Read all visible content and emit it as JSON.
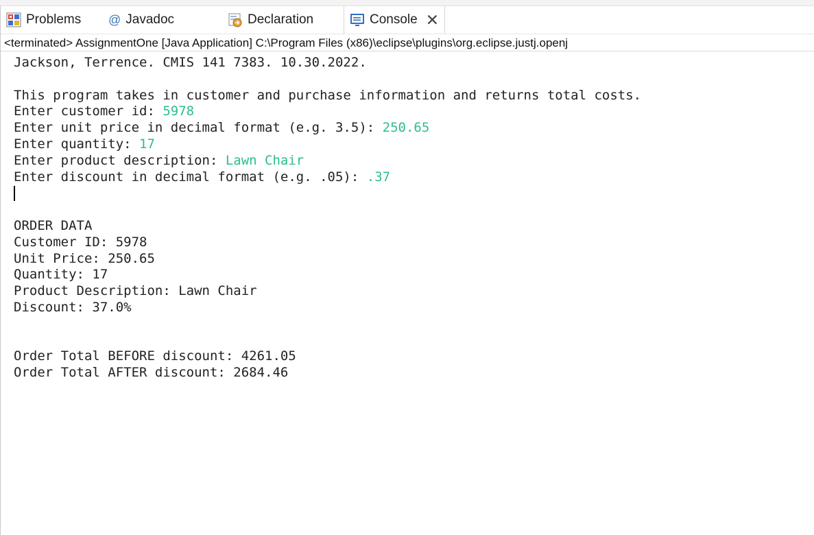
{
  "tabs": [
    {
      "label": "Problems",
      "icon": "problems-icon"
    },
    {
      "label": "Javadoc",
      "icon": "at-icon",
      "glyph": "@"
    },
    {
      "label": "Declaration",
      "icon": "declaration-icon"
    },
    {
      "label": "Console",
      "icon": "console-icon",
      "active": true,
      "close": "✕"
    }
  ],
  "status": "<terminated> AssignmentOne [Java Application] C:\\Program Files (x86)\\eclipse\\plugins\\org.eclipse.justj.openj",
  "console": {
    "header": "Jackson, Terrence. CMIS 141 7383. 10.30.2022.",
    "intro": "This program takes in customer and purchase information and returns total costs.",
    "prompts": [
      {
        "prompt": "Enter customer id: ",
        "value": "5978"
      },
      {
        "prompt": "Enter unit price in decimal format (e.g. 3.5): ",
        "value": "250.65"
      },
      {
        "prompt": "Enter quantity: ",
        "value": "17"
      },
      {
        "prompt": "Enter product description: ",
        "value": "Lawn Chair"
      },
      {
        "prompt": "Enter discount in decimal format (e.g. .05): ",
        "value": ".37"
      }
    ],
    "order_heading": "ORDER DATA",
    "order_lines": [
      "Customer ID: 5978",
      "Unit Price: 250.65",
      "Quantity: 17",
      "Product Description: Lawn Chair",
      "Discount: 37.0%"
    ],
    "totals": [
      "Order Total BEFORE discount: 4261.05",
      "Order Total AFTER discount: 2684.46"
    ]
  },
  "colors": {
    "input": "#2bbf8a",
    "text": "#222222"
  }
}
